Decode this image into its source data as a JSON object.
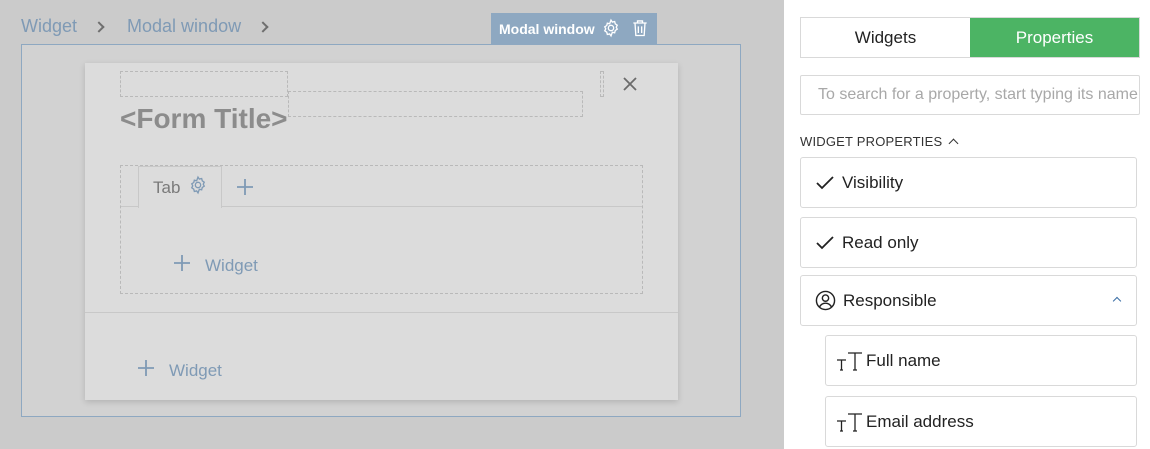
{
  "breadcrumb": {
    "items": [
      "Widget",
      "Modal window"
    ]
  },
  "modal_tag": {
    "label": "Modal window"
  },
  "form": {
    "title": "<Form Title>"
  },
  "tabs": {
    "tab_label": "Tab"
  },
  "widgets": {
    "inner_add_label": "Widget",
    "outer_add_label": "Widget"
  },
  "panel": {
    "tabs": [
      {
        "label": "Widgets",
        "active": false
      },
      {
        "label": "Properties",
        "active": true
      }
    ],
    "search_placeholder": "To search for a property, start typing its name",
    "section_title": "WIDGET PROPERTIES",
    "properties": [
      {
        "label": "Visibility",
        "icon": "check-icon"
      },
      {
        "label": "Read only",
        "icon": "check-icon"
      },
      {
        "label": "Responsible",
        "icon": "user-circle-icon"
      }
    ],
    "responsible_fields": [
      {
        "label": "Full name",
        "icon": "text-type-icon"
      },
      {
        "label": "Email address",
        "icon": "text-type-icon"
      }
    ]
  },
  "colors": {
    "accent_green": "#4cb464",
    "selection_blue": "#8ea8c1",
    "link_blue": "#7f9ab5"
  }
}
